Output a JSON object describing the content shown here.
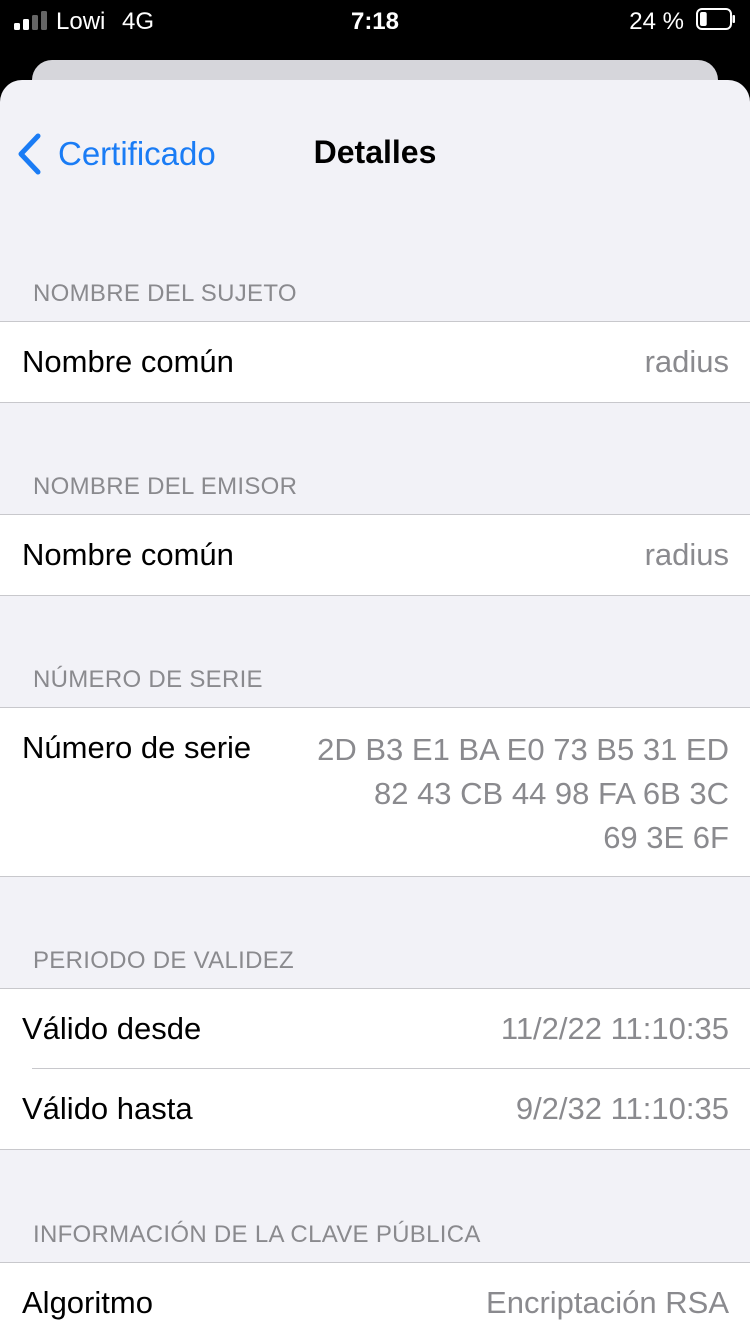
{
  "status_bar": {
    "carrier": "Lowi",
    "network": "4G",
    "time": "7:18",
    "battery_percent": "24 %",
    "battery_level": 0.24
  },
  "nav": {
    "back_label": "Certificado",
    "title": "Detalles"
  },
  "sections": [
    {
      "header": "NOMBRE DEL SUJETO",
      "rows": [
        {
          "label": "Nombre común",
          "value": "radius"
        }
      ]
    },
    {
      "header": "NOMBRE DEL EMISOR",
      "rows": [
        {
          "label": "Nombre común",
          "value": "radius"
        }
      ]
    },
    {
      "header": "NÚMERO DE SERIE",
      "rows": [
        {
          "label": "Número de serie",
          "value_lines": [
            "2D B3 E1 BA E0 73 B5 31 ED",
            "82 43 CB 44 98 FA 6B 3C",
            "69 3E 6F"
          ]
        }
      ]
    },
    {
      "header": "PERIODO DE VALIDEZ",
      "rows": [
        {
          "label": "Válido desde",
          "value": "11/2/22 11:10:35"
        },
        {
          "label": "Válido hasta",
          "value": "9/2/32 11:10:35"
        }
      ]
    },
    {
      "header": "INFORMACIÓN DE LA CLAVE PÚBLICA",
      "rows": [
        {
          "label": "Algoritmo",
          "value": "Encriptación RSA"
        }
      ]
    }
  ],
  "colors": {
    "accent": "#1a7cf5",
    "secondary_text": "#8a8a8e",
    "grouped_background": "#f2f2f7"
  }
}
